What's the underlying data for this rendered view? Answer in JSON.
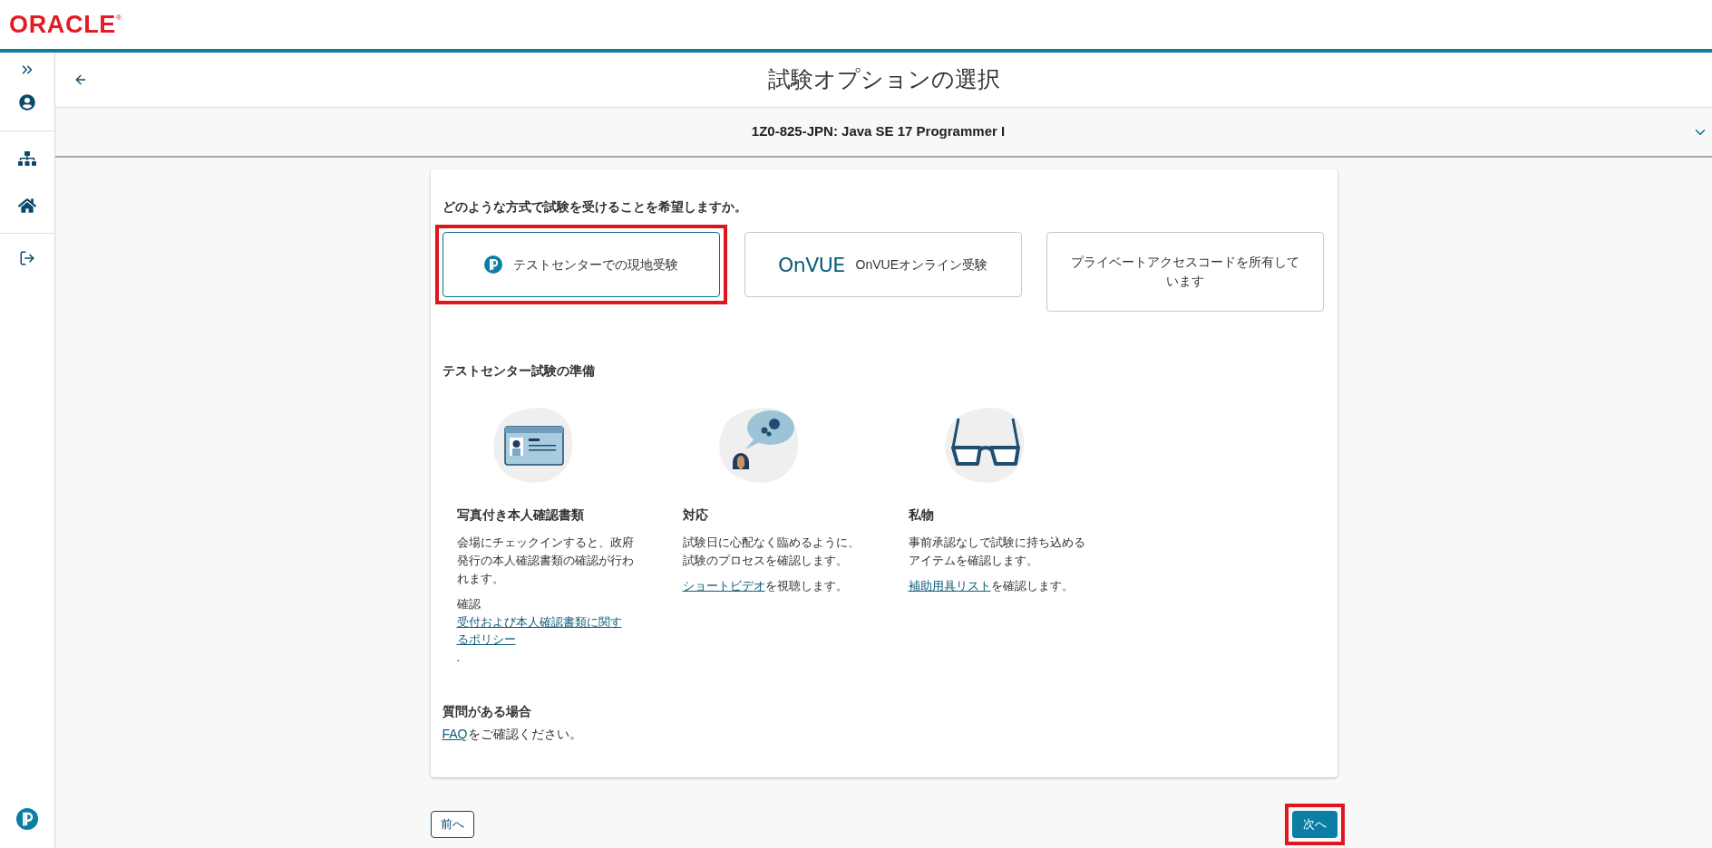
{
  "header": {
    "logo": "ORACLE",
    "logo_mark": "®"
  },
  "page": {
    "title": "試験オプションの選択"
  },
  "exam": {
    "name": "1Z0-825-JPN: Java SE 17 Programmer I",
    "expanded": false
  },
  "question": "どのような方式で試験を受けることを希望しますか。",
  "options": [
    {
      "kind": "pearson",
      "label": "テストセンターでの現地受験",
      "selected": true,
      "highlighted": true
    },
    {
      "kind": "onvue",
      "logo": "OnVUE",
      "label": "OnVUEオンライン受験",
      "selected": false,
      "highlighted": false
    },
    {
      "kind": "plain",
      "label": "プライベートアクセスコードを所有しています",
      "selected": false,
      "highlighted": false
    }
  ],
  "prep": {
    "heading": "テストセンター試験の準備",
    "items": [
      {
        "kind": "id-card",
        "title": "写真付き本人確認書類",
        "text": "会場にチェックインすると、政府発行の本人確認書類の確認が行われます。",
        "link_line": {
          "kind": "block",
          "prefix": "確認",
          "link": "受付および本人確認書類に関するポリシー",
          "suffix": "."
        }
      },
      {
        "kind": "speech",
        "title": "対応",
        "text": "試験日に心配なく臨めるように、試験のプロセスを確認します。",
        "link_line": {
          "kind": "inline",
          "link": "ショートビデオ",
          "suffix": "を視聴します。"
        }
      },
      {
        "kind": "glasses",
        "title": "私物",
        "text": "事前承認なしで試験に持ち込めるアイテムを確認します。",
        "link_line": {
          "kind": "inline",
          "link": "補助用具リスト",
          "suffix": "を確認します。"
        }
      }
    ]
  },
  "help": {
    "heading": "質問がある場合",
    "link": "FAQ",
    "text": "をご確認ください。"
  },
  "nav": {
    "back": "前へ",
    "next": "次へ",
    "next_highlighted": true
  }
}
